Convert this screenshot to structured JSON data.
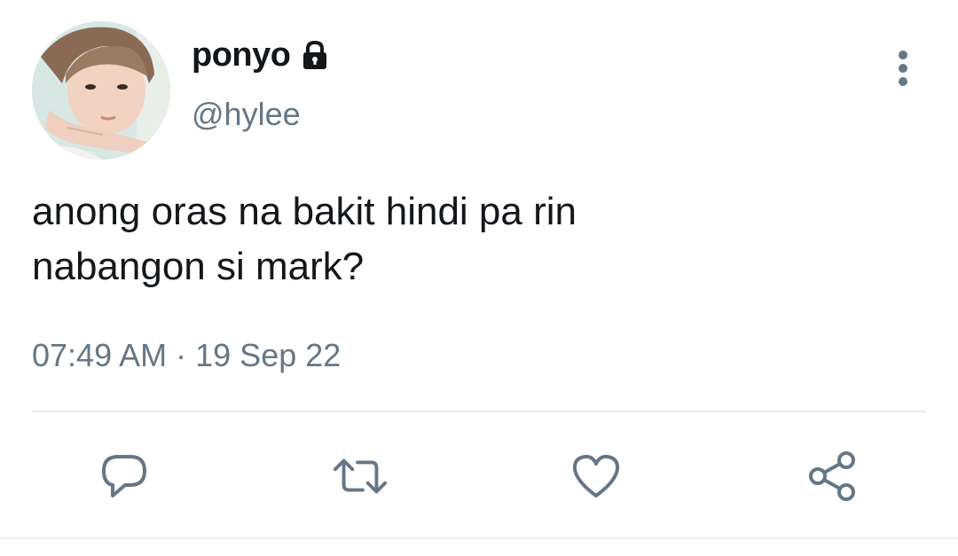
{
  "tweet": {
    "display_name": "ponyo",
    "handle": "@hylee",
    "protected_icon": "lock-icon",
    "text_lines": [
      "anong oras na bakit hindi pa rin",
      "nabangon si mark?"
    ],
    "time": "07:49 AM",
    "separator": "·",
    "date": "19 Sep 22"
  },
  "actions": {
    "reply_icon": "speech-bubble-icon",
    "retweet_icon": "retweet-icon",
    "like_icon": "heart-icon",
    "share_icon": "share-icon",
    "more_icon": "vertical-ellipsis-icon"
  },
  "colors": {
    "text": "#14171a",
    "secondary": "#657786",
    "divider": "#e6ecf0"
  }
}
